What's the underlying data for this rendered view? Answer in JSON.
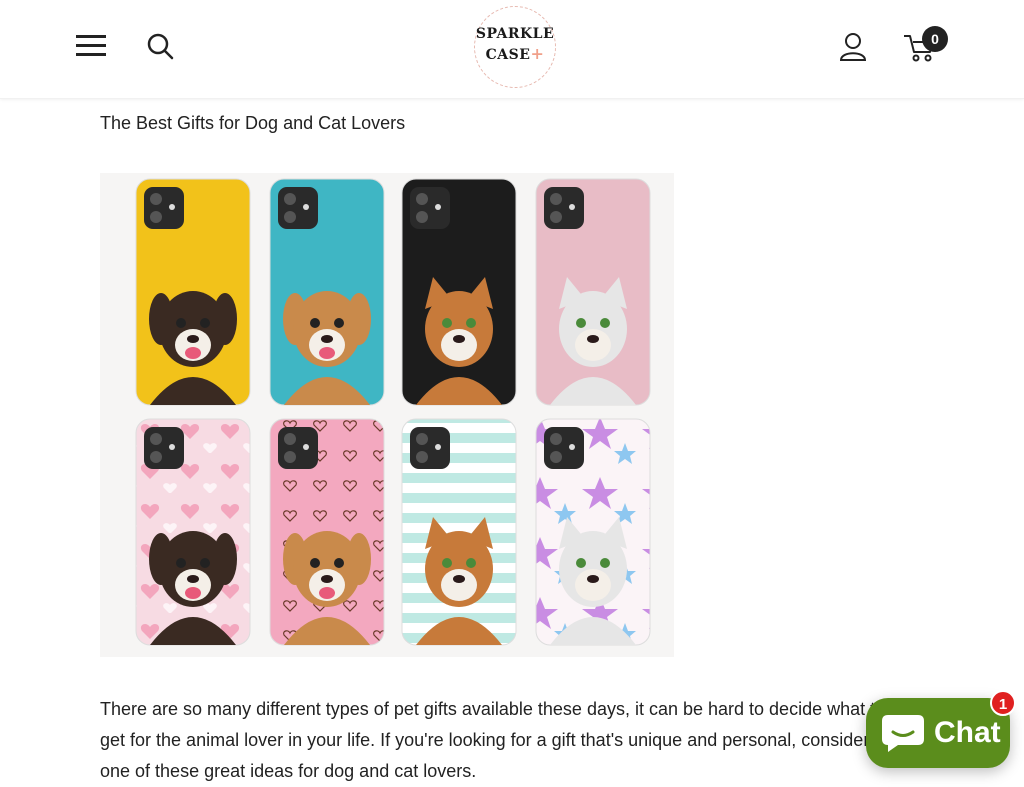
{
  "header": {
    "logo_line1": "SPARKLE",
    "logo_line2": "CASE",
    "logo_plus": "+",
    "cart_count": "0",
    "icons": [
      "hamburger-menu-icon",
      "search-icon",
      "user-account-icon",
      "shopping-cart-icon"
    ]
  },
  "article": {
    "title": "The Best Gifts for Dog and Cat Lovers",
    "hero_image_subject": "Eight personalized phone cases with dog and cat portraits",
    "body": "There are so many different types of pet gifts available these days, it can be hard to decide what to get for the animal lover in your life. If you're looking for a gift that's unique and personal, consider one of these great ideas for dog and cat lovers."
  },
  "chat": {
    "label": "Chat",
    "badge": "1",
    "color": "#5b8d1c"
  },
  "colors": {
    "case_yellow": "#f2c21a",
    "case_teal": "#3fb6c4",
    "case_black": "#1c1c1c",
    "case_pink": "#e8bcc6"
  }
}
